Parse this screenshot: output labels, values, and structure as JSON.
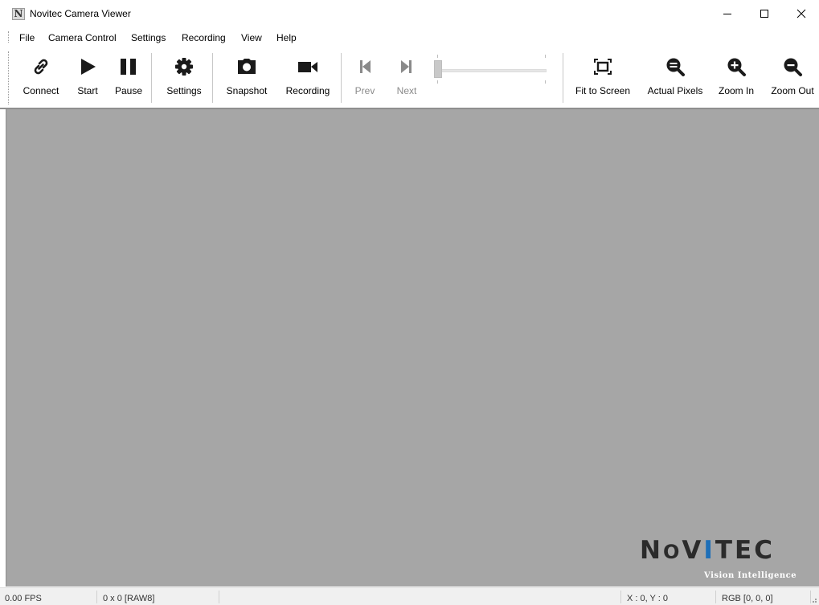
{
  "window": {
    "app_icon_letter": "N",
    "title": "Novitec Camera Viewer"
  },
  "menu": [
    "File",
    "Camera Control",
    "Settings",
    "Recording",
    "View",
    "Help"
  ],
  "toolbar": {
    "connect": "Connect",
    "start": "Start",
    "pause": "Pause",
    "settings": "Settings",
    "snapshot": "Snapshot",
    "recording": "Recording",
    "prev": "Prev",
    "next": "Next",
    "frame_slider_value": 0,
    "fit_to_screen": "Fit to Screen",
    "actual_pixels": "Actual Pixels",
    "zoom_in": "Zoom In",
    "zoom_out": "Zoom Out"
  },
  "icons": {
    "connect": "link-icon",
    "start": "play-icon",
    "pause": "pause-icon",
    "settings": "gear-icon",
    "snapshot": "camera-icon",
    "recording": "video-camera-icon",
    "prev": "skip-previous-icon",
    "next": "skip-next-icon",
    "fit_to_screen": "fit-screen-icon",
    "actual_pixels": "magnifier-icon",
    "zoom_in": "zoom-in-icon",
    "zoom_out": "zoom-out-icon"
  },
  "viewer": {
    "background_color": "#a6a6a6",
    "logo_text": "NOVITEC",
    "logo_tagline": "Vision Intelligence"
  },
  "status": {
    "fps": "0.00 FPS",
    "resolution": "0 x 0 [RAW8]",
    "coords": "X : 0, Y : 0",
    "rgb": "RGB [0, 0, 0]"
  }
}
